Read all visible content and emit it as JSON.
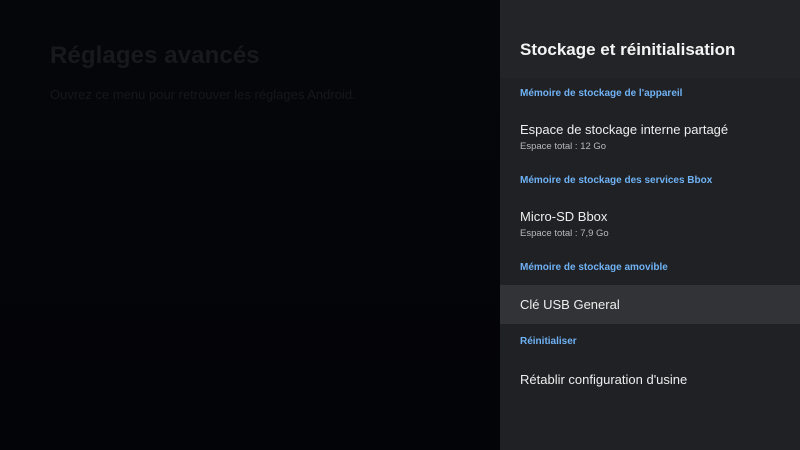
{
  "background": {
    "title": "Réglages avancés",
    "subtitle": "Ouvrez ce menu pour retrouver les réglages Android."
  },
  "panel": {
    "title": "Stockage et réinitialisation",
    "sections": {
      "device": "Mémoire de stockage de l'appareil",
      "bbox_services": "Mémoire de stockage des services Bbox",
      "removable": "Mémoire de stockage amovible",
      "reset": "Réinitialiser"
    },
    "items": {
      "internal": {
        "title": "Espace de stockage interne partagé",
        "subtitle": "Espace total : 12 Go"
      },
      "microsd": {
        "title": "Micro-SD Bbox",
        "subtitle": "Espace total : 7,9 Go"
      },
      "usb": {
        "title": "Clé USB General"
      },
      "factory_reset": {
        "title": "Rétablir configuration d'usine"
      }
    }
  },
  "colors": {
    "accent": "#6fb2f5",
    "panel_bg": "#202124",
    "focus_bg": "#323336"
  }
}
